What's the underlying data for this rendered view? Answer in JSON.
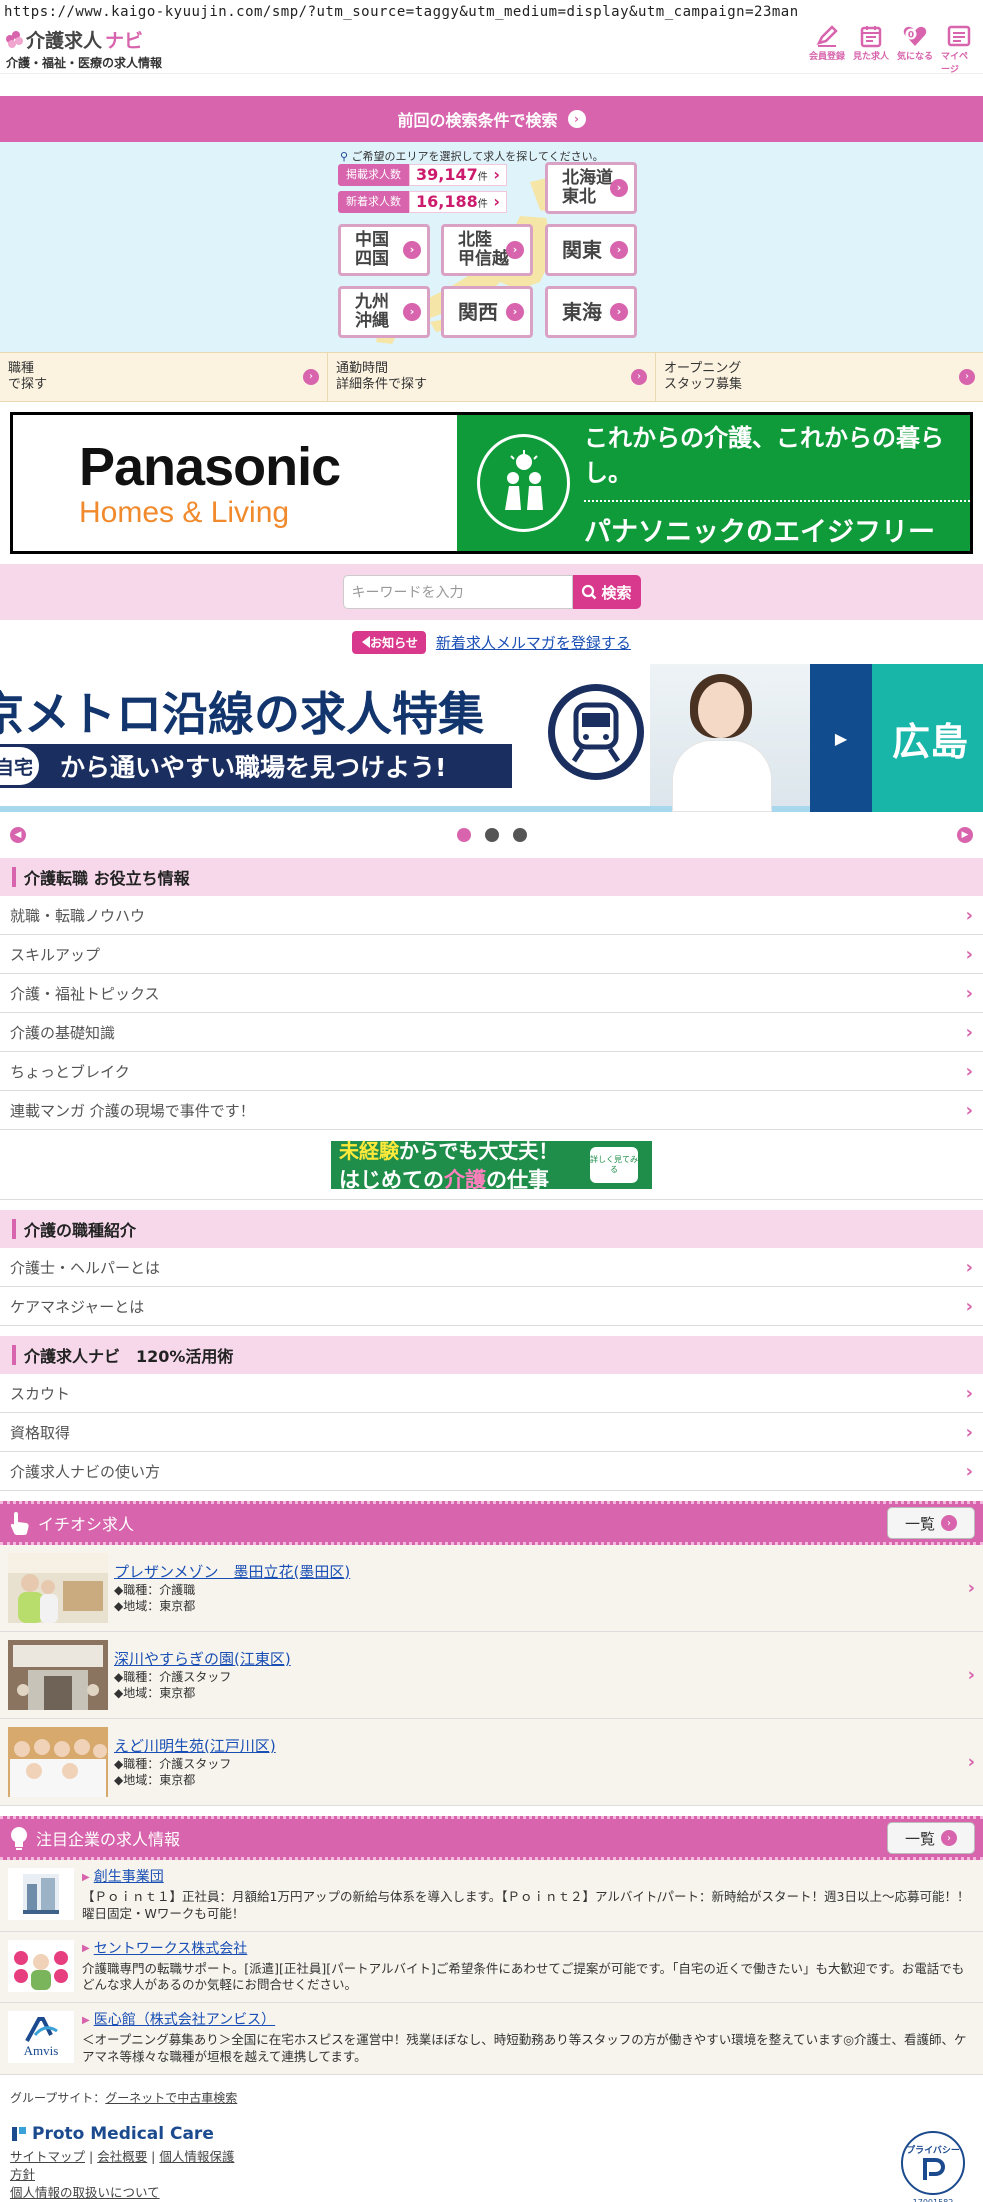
{
  "url": "https://www.kaigo-kyuujin.com/smp/?utm_source=taggy&utm_medium=display&utm_campaign=23man",
  "header": {
    "logo_main": "介護求人",
    "logo_nav": "ナビ",
    "logo_sub": "介護・福祉・医療の求人情報",
    "icons": [
      {
        "name": "member-register-icon",
        "label": "会員登録"
      },
      {
        "name": "viewed-jobs-icon",
        "label": "見た求人"
      },
      {
        "name": "favorite-icon",
        "label": "気になる",
        "badge": "0"
      },
      {
        "name": "mypage-icon",
        "label": "マイページ"
      }
    ]
  },
  "prev_search": "前回の検索条件で検索",
  "area": {
    "note": "ご希望のエリアを選択して求人を探してください。",
    "counts": [
      {
        "label": "掲載求人数",
        "value": "39,147",
        "unit": "件"
      },
      {
        "label": "新着求人数",
        "value": "16,188",
        "unit": "件"
      }
    ],
    "regions": {
      "hokkaido_tohoku": "北海道\n東北",
      "chugoku_shikoku": "中国\n四国",
      "hokuriku": "北陸\n甲信越",
      "kanto": "関東",
      "kyushu": "九州\n沖縄",
      "kansai": "関西",
      "tokai": "東海"
    }
  },
  "search_tabs": [
    {
      "line1": "職種",
      "line2": "で探す"
    },
    {
      "line1": "通勤時間",
      "line2": "詳細条件で探す"
    },
    {
      "line1": "オープニング",
      "line2": "スタッフ募集"
    }
  ],
  "panasonic": {
    "name": "Panasonic",
    "sub": "Homes & Living",
    "tagline": "これからの介護、これからの暮らし。",
    "brand": "パナソニックのエイジフリー"
  },
  "keyword": {
    "placeholder": "キーワードを入力",
    "button": "検索"
  },
  "notice": {
    "badge": "お知らせ",
    "link": "新着求人メルマガを登録する"
  },
  "slider": {
    "title": "京メトロ沿線の求人特集",
    "home": "自宅",
    "band": "から通いやすい職場を見つけよう!",
    "next_title": "広島",
    "dots": 3,
    "active": 0
  },
  "sections": [
    {
      "title": "介護転職 お役立ち情報",
      "items": [
        "就職・転職ノウハウ",
        "スキルアップ",
        "介護・福祉トピックス",
        "介護の基礎知識",
        "ちょっとブレイク",
        "連載マンガ 介護の現場で事件です！"
      ]
    },
    {
      "title": "介護の職種紹介",
      "items": [
        "介護士・ヘルパーとは",
        "ケアマネジャーとは"
      ]
    },
    {
      "title": "介護求人ナビ　120%活用術",
      "items": [
        "スカウト",
        "資格取得",
        "介護求人ナビの使い方"
      ]
    }
  ],
  "inexp_banner": {
    "line1_highlight": "未経験",
    "line1_rest": "からでも大丈夫！",
    "line2_pre": "はじめての",
    "line2_highlight": "介護",
    "line2_post": "の仕事",
    "badge": "詳しく見てみる"
  },
  "featured": {
    "title": "イチオシ求人",
    "list_btn": "一覧",
    "jobs": [
      {
        "title": "プレザンメゾン　墨田立花(墨田区)",
        "job": "◆職種：介護職",
        "area": "◆地域：東京都"
      },
      {
        "title": "深川やすらぎの園(江東区)",
        "job": "◆職種：介護スタッフ",
        "area": "◆地域：東京都"
      },
      {
        "title": "えど川明生苑(江戸川区)",
        "job": "◆職種：介護スタッフ",
        "area": "◆地域：東京都"
      }
    ]
  },
  "companies": {
    "title": "注目企業の求人情報",
    "list_btn": "一覧",
    "items": [
      {
        "name": "創生事業団",
        "desc": "【Ｐｏｉｎｔ１】正社員：月額給1万円アップの新給与体系を導入します。【Ｐｏｉｎｔ２】アルバイト/パート：新時給がスタート！週3日以上～応募可能！！曜日固定・Wワークも可能！"
      },
      {
        "name": "セントワークス株式会社",
        "desc": "介護職専門の転職サポート。[派遣][正社員][パートアルバイト]ご希望条件にあわせてご提案が可能です。「自宅の近くで働きたい」も大歓迎です。お電話でもどんな求人があるのか気軽にお問合せください。"
      },
      {
        "name": "医心館（株式会社アンビス）",
        "desc": "＜オープニング募集あり＞全国に在宅ホスピスを運営中！残業ほぼなし、時短勤務あり等スタッフの方が働きやすい環境を整えています◎介護士、看護師、ケアマネ等様々な職種が垣根を越えて連携してます。",
        "logo_text": "Amvis"
      }
    ]
  },
  "footer": {
    "group_label": "グループサイト：",
    "group_link": "グーネットで中古車検索",
    "company": "Proto Medical Care",
    "links": [
      "サイトマップ",
      "会社概要",
      "個人情報保護方針"
    ],
    "privacy_link": "個人情報の取扱いについて",
    "privacy_mark_num": "17001582",
    "privacy_mark_text": "プライバシー"
  },
  "colors": {
    "accent": "#d764ac",
    "pink_light": "#f6d8ea",
    "green": "#0f9b3a"
  }
}
